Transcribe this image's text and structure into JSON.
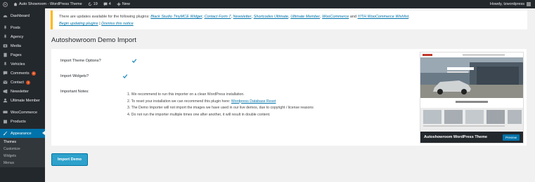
{
  "adminbar": {
    "site_name": "Auto Showroom - WordPress Theme",
    "updates_count": "19",
    "comments_count": "4",
    "new_label": "New",
    "howdy": "Howdy, tzwordpress"
  },
  "sidebar": {
    "items": [
      {
        "label": "Dashboard",
        "icon": "dashboard-icon"
      },
      {
        "label": "Posts",
        "icon": "pin-icon"
      },
      {
        "label": "Agency",
        "icon": "pin-icon"
      },
      {
        "label": "Media",
        "icon": "media-icon"
      },
      {
        "label": "Pages",
        "icon": "page-icon"
      },
      {
        "label": "Vehicles",
        "icon": "pin-icon"
      },
      {
        "label": "Comments",
        "icon": "comment-icon",
        "badge": "4"
      },
      {
        "label": "Contact",
        "icon": "mail-icon",
        "badge": "1"
      },
      {
        "label": "Newsletter",
        "icon": "newsletter-icon"
      },
      {
        "label": "Ultimate Member",
        "icon": "users-icon"
      },
      {
        "label": "WooCommerce",
        "icon": "cart-icon"
      },
      {
        "label": "Products",
        "icon": "box-icon"
      },
      {
        "label": "Appearance",
        "icon": "brush-icon"
      }
    ],
    "submenu": [
      "Themes",
      "Customize",
      "Widgets",
      "Menus"
    ]
  },
  "notice": {
    "text_prefix": "There are updates available for the following plugins:",
    "plugins": [
      "Black Studio TinyMCE Widget",
      "Contact Form 7",
      "Newsletter",
      "Shortcodes Ultimate",
      "Ultimate Member",
      "WooCommerce"
    ],
    "and_text": "and",
    "last_plugin": "YITH WooCommerce Wishlist",
    "begin_link": "Begin updating plugins",
    "separator": "|",
    "dismiss_link": "Dismiss this notice"
  },
  "page": {
    "title": "Autoshowroom Demo Import"
  },
  "form": {
    "theme_options_label": "Import Theme Options?",
    "theme_options_checked": true,
    "widgets_label": "Import Widgets?",
    "widgets_checked": true,
    "notes_label": "Important Notes:",
    "notes": [
      "1. We recommend to run this importer on a clean WordPress installation.",
      "2. To reset your installation we can recommend this plugin here:",
      "3. The Demo Importer will not import the images we have used in our live demos, due to copyright / license reasons",
      "4. Do not run the importer multiple times one after another, it will result in double content."
    ],
    "reset_link": "Wordpress Database Reset",
    "import_button": "Import Demo"
  },
  "theme_card": {
    "name": "Autoshowroom WordPress Theme",
    "preview_button": "Preview"
  },
  "colors": {
    "admin_dark": "#23282d",
    "accent_blue": "#0073aa",
    "notice_yellow": "#ffb900",
    "button_blue": "#2ea2cc"
  }
}
